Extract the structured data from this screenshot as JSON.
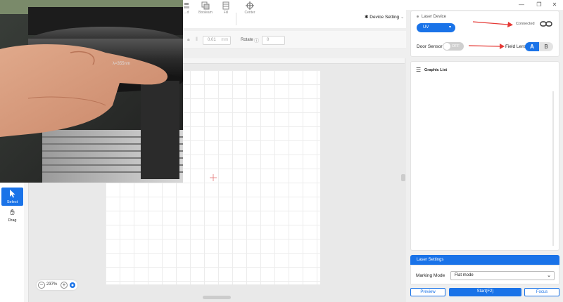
{
  "window": {
    "minimize_glyph": "—",
    "restore_glyph": "❐",
    "close_glyph": "✕"
  },
  "toolbar": {
    "items": [
      {
        "label": "...d",
        "icon": "align-icon"
      },
      {
        "label": "Booleam",
        "icon": "boolean-icon"
      },
      {
        "label": "Fill",
        "icon": "fill-icon"
      },
      {
        "label": "Center",
        "icon": "crosshair-icon"
      }
    ],
    "device_setting_label": "Device Setting"
  },
  "params": {
    "step_value": "0.01",
    "step_unit": "mm",
    "rotate_label": "Rotate",
    "rotate_value": "0"
  },
  "tools": {
    "select_label": "Select",
    "drag_label": "Drag"
  },
  "zoom": {
    "value": "237%",
    "minus": "−",
    "plus": "+"
  },
  "device": {
    "section_label": "Laser Device",
    "laser_type": "UV",
    "status": "Connected",
    "door_sensor_label": "Door Sensor",
    "door_sensor_state": "OFF",
    "field_lens_label": "Field Lens",
    "lens_a": "A",
    "lens_b": "B"
  },
  "graphic_list": {
    "title": "Graphic List"
  },
  "laser_settings": {
    "title": "Laser Settings",
    "marking_mode_label": "Marking Mode",
    "marking_mode_value": "Flat mode"
  },
  "actions": {
    "preview": "Preview",
    "start": "Start(F2)",
    "focus": "Focus"
  },
  "camera_overlay": {
    "lens_text": "λ=355nm"
  },
  "colors": {
    "accent": "#1a73e8",
    "arrow": "#e53935"
  }
}
